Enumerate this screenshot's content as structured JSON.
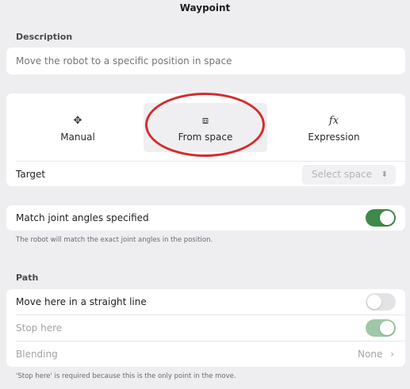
{
  "title": "Waypoint",
  "description": {
    "label": "Description",
    "placeholder": "Move the robot to a specific position in space"
  },
  "modes": [
    {
      "label": "Manual",
      "icon": "move-arrows-icon",
      "glyph": "✥",
      "selected": false
    },
    {
      "label": "From space",
      "icon": "scan-cube-icon",
      "glyph": "⧈",
      "selected": true
    },
    {
      "label": "Expression",
      "icon": "function-icon",
      "glyph": "𝑓x",
      "selected": false
    }
  ],
  "target": {
    "label": "Target",
    "select_value": "Select space",
    "chevron": "⌃⌄"
  },
  "match_joint": {
    "label": "Match joint angles specified",
    "enabled": true,
    "hint": "The robot will match the exact joint angles in the position."
  },
  "path": {
    "label": "Path",
    "straight_line": {
      "label": "Move here in a straight line",
      "enabled": false
    },
    "stop_here": {
      "label": "Stop here",
      "enabled": true,
      "disabled": true
    },
    "blending": {
      "label": "Blending",
      "value": "None",
      "chevron": "›"
    },
    "hint": "'Stop here' is required because this is the only point in the move."
  },
  "colors": {
    "toggle_on": "#3d8a4b",
    "toggle_on_disabled": "#9fc8a6",
    "annotation": "#d62c2c"
  }
}
